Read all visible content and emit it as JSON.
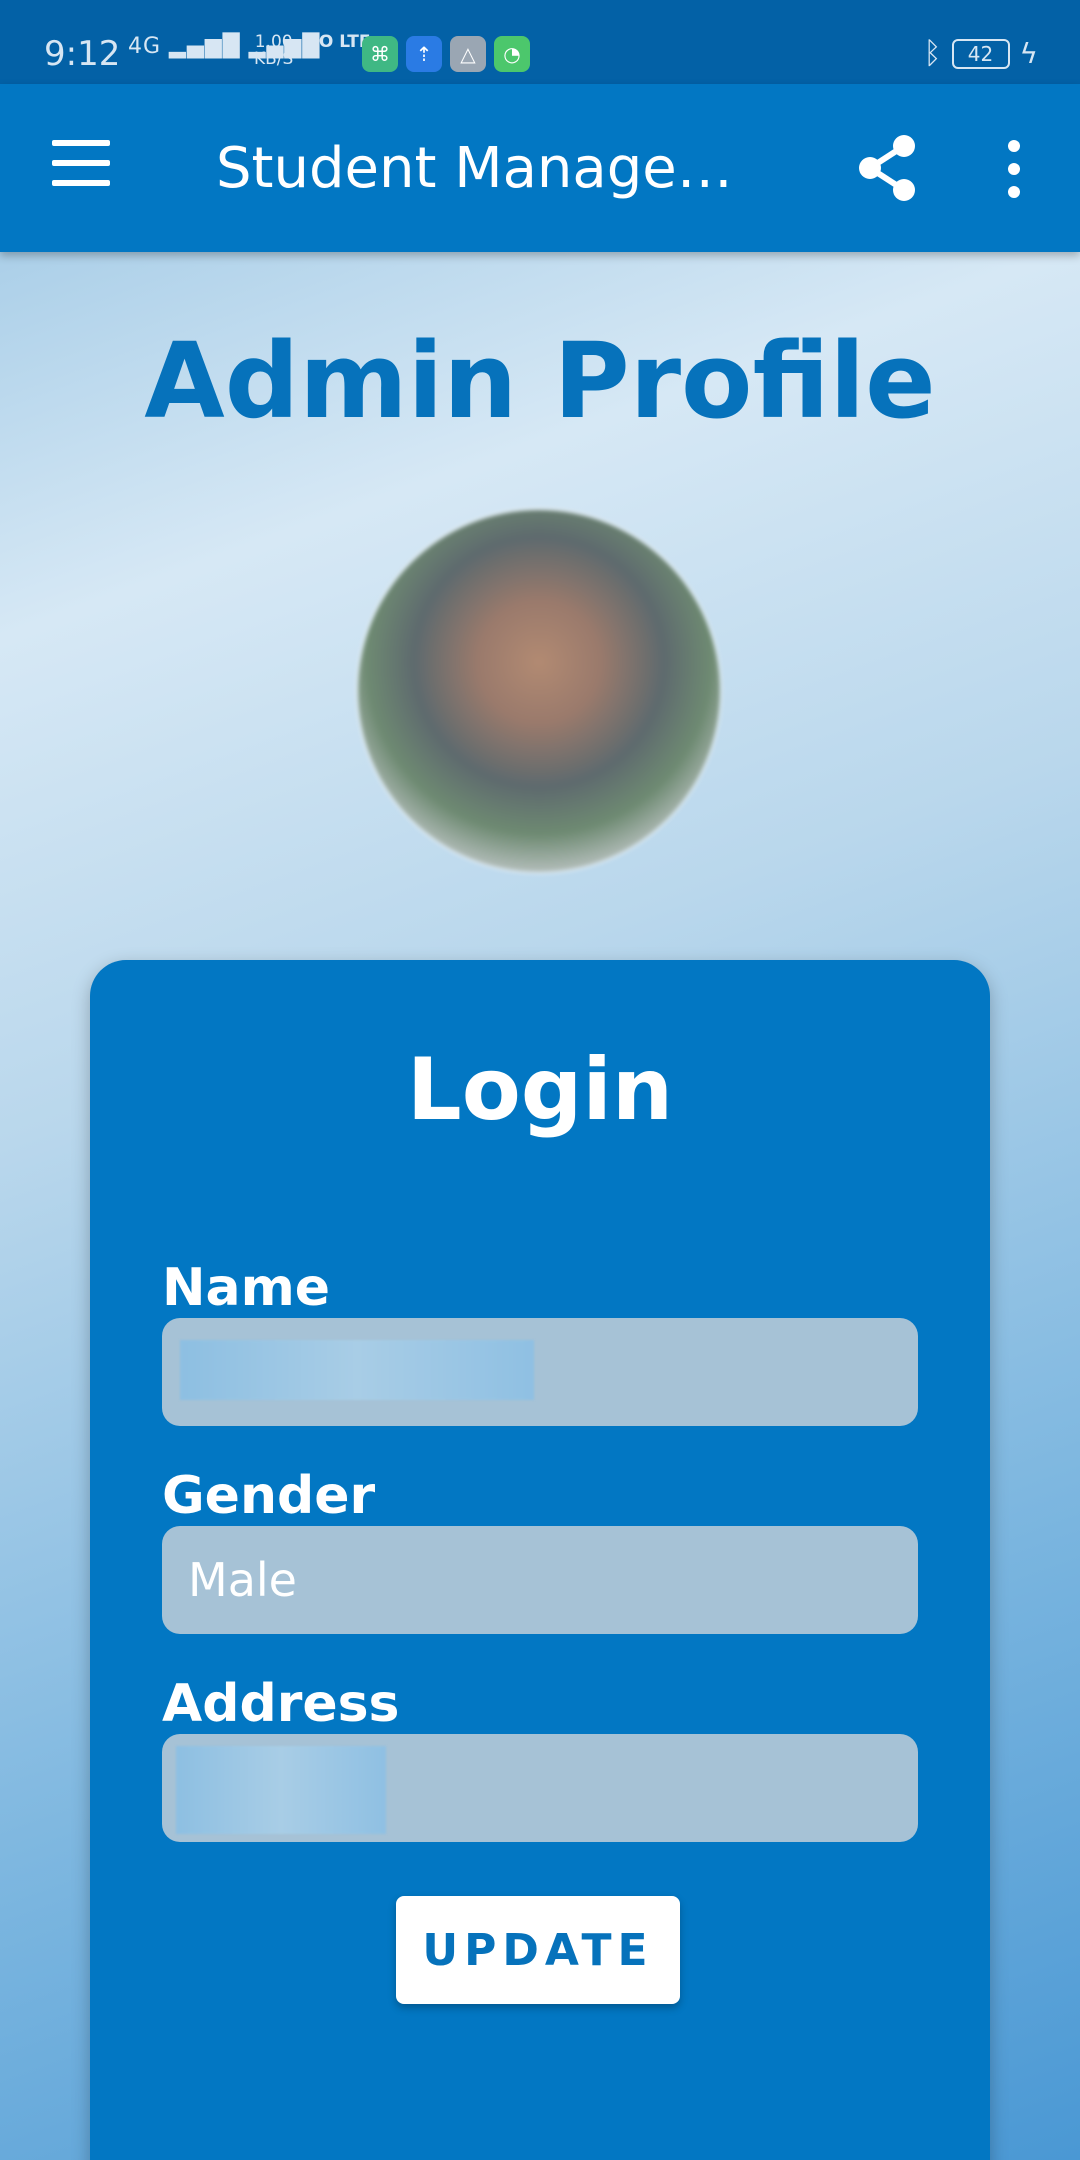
{
  "status_bar": {
    "time": "9:12",
    "network": "4G",
    "speed_value": "1.00",
    "speed_unit": "KB/S",
    "volte": "VO LTE",
    "battery": "42"
  },
  "app_bar": {
    "title": "Student Managem…",
    "menu_icon": "hamburger-menu-icon",
    "share_icon": "share-icon",
    "more_icon": "more-vert-icon"
  },
  "page": {
    "title": "Admin Profile"
  },
  "card": {
    "title": "Login",
    "fields": {
      "name": {
        "label": "Name",
        "value": ""
      },
      "gender": {
        "label": "Gender",
        "value": "Male"
      },
      "address": {
        "label": "Address",
        "value": ""
      }
    },
    "update_label": "UPDATE"
  },
  "colors": {
    "status_bar": "#0361a6",
    "app_bar": "#0277c3",
    "card": "#0277c3",
    "title_text": "#0672bb",
    "field_bg": "#a6c2d6"
  }
}
